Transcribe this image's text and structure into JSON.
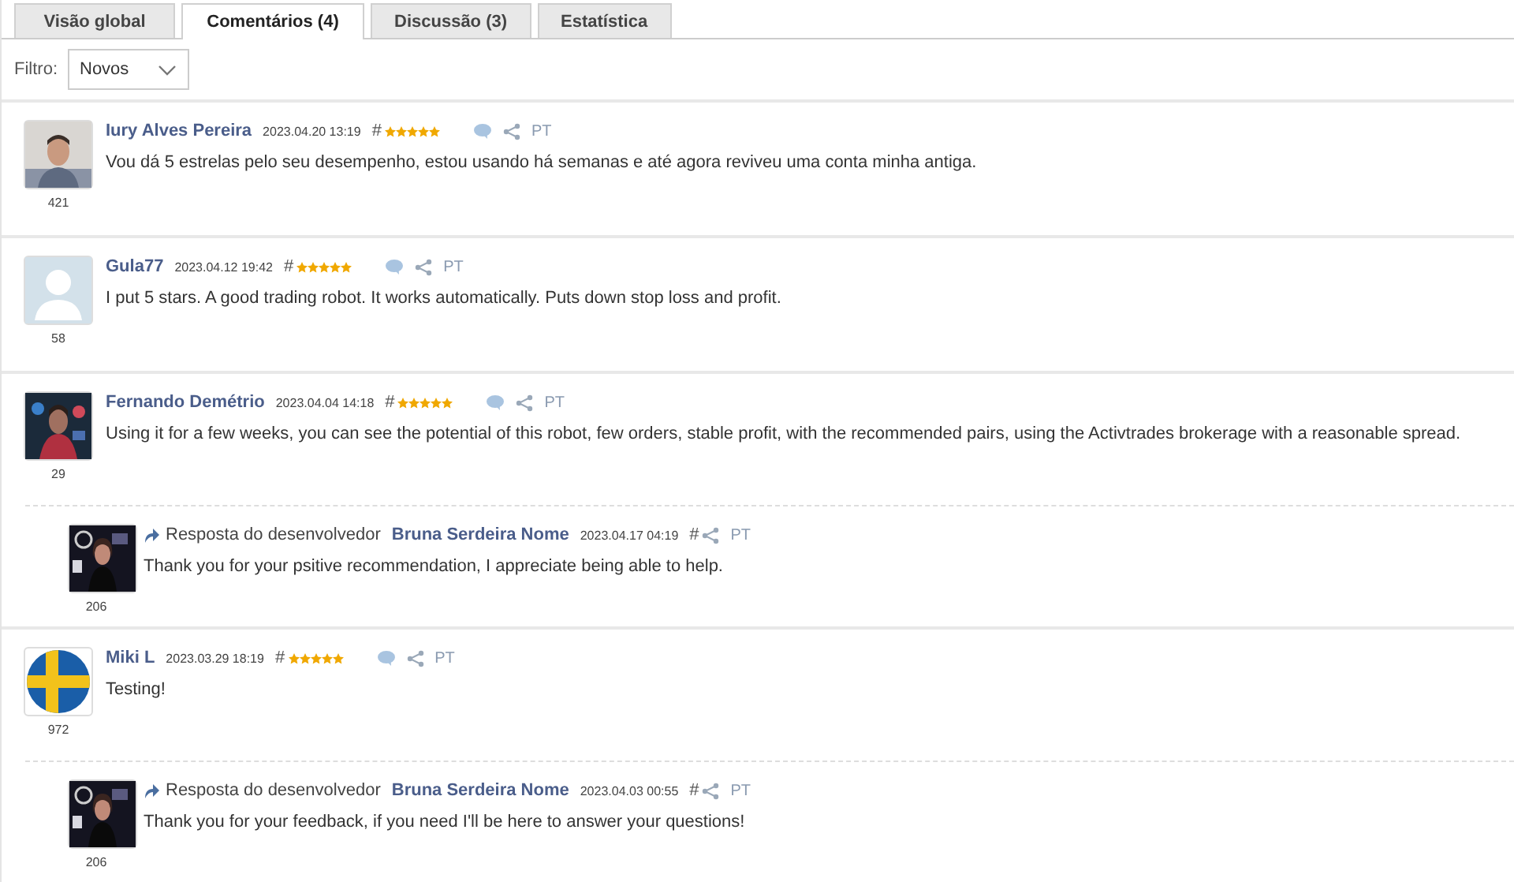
{
  "tabs": [
    {
      "label": "Visão global",
      "selected": false
    },
    {
      "label": "Comentários (4)",
      "selected": true
    },
    {
      "label": "Discussão (3)",
      "selected": false
    },
    {
      "label": "Estatística",
      "selected": false
    }
  ],
  "filter": {
    "label": "Filtro:",
    "value": "Novos"
  },
  "comments": [
    {
      "rating": "421",
      "author": "Iury Alves Pereira",
      "date": "2023.04.20 13:19",
      "hash": "#",
      "stars": 5,
      "lang": "PT",
      "text": "Vou dá 5 estrelas pelo seu desempenho, estou usando há semanas e até agora reviveu uma conta minha antiga."
    },
    {
      "avatar": {
        "kind": "silhouette"
      },
      "rating": "58",
      "author": "Gula77",
      "date": "2023.04.12 19:42",
      "hash": "#",
      "stars": 5,
      "lang": "PT",
      "text": "I put 5 stars. A good trading robot. It works automatically. Puts down stop loss and profit."
    },
    {
      "rating": "29",
      "author": "Fernando Demétrio",
      "date": "2023.04.04 14:18",
      "hash": "#",
      "stars": 5,
      "lang": "PT",
      "text": "Using it for a few weeks, you can see the potential of this robot, few orders, stable profit, with the recommended pairs, using the Activtrades brokerage with a reasonable spread.",
      "replies": [
        {
          "rating": "206",
          "label": "Resposta do desenvolvedor",
          "author": "Bruna Serdeira Nome",
          "date": "2023.04.17 04:19",
          "hash": "#",
          "lang": "PT",
          "text": "Thank you for your psitive recommendation, I appreciate being able to help."
        }
      ]
    },
    {
      "avatar": {
        "kind": "flag"
      },
      "rating": "972",
      "author": "Miki L",
      "date": "2023.03.29 18:19",
      "hash": "#",
      "stars": 5,
      "lang": "PT",
      "text": "Testing!",
      "replies": [
        {
          "rating": "206",
          "label": "Resposta do desenvolvedor",
          "author": "Bruna Serdeira Nome",
          "date": "2023.04.03 00:55",
          "hash": "#",
          "lang": "PT",
          "text": "Thank you for your feedback, if you need I'll be here to answer your questions!"
        }
      ]
    }
  ]
}
